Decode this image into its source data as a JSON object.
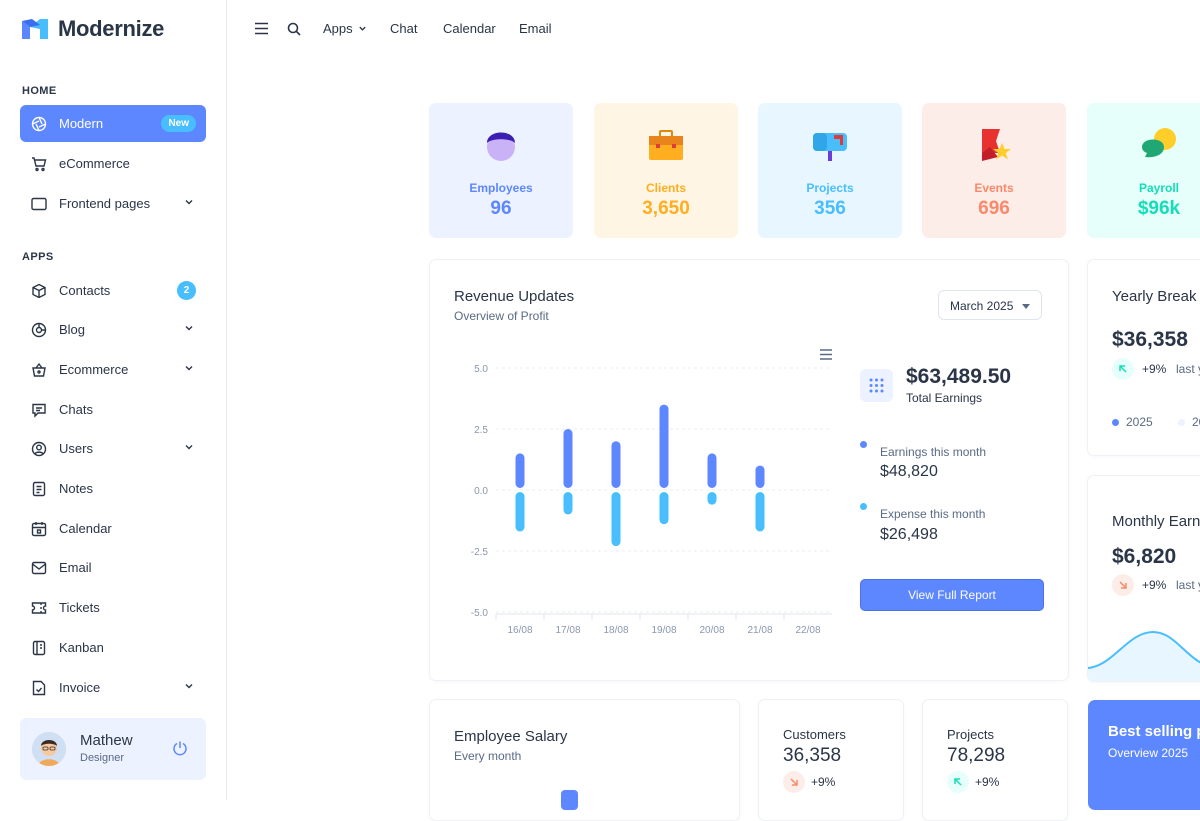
{
  "app": {
    "name": "Modernize"
  },
  "sidebar": {
    "sections": [
      {
        "label": "HOME"
      },
      {
        "label": "APPS"
      }
    ],
    "items": [
      {
        "label": "Modern",
        "icon": "aperture-icon",
        "badge": "New"
      },
      {
        "label": "eCommerce",
        "icon": "shopping-cart-icon"
      },
      {
        "label": "Frontend pages",
        "icon": "app-window-icon"
      },
      {
        "label": "Contacts",
        "icon": "box-icon",
        "badge": "2"
      },
      {
        "label": "Blog",
        "icon": "chart-donut-icon"
      },
      {
        "label": "Ecommerce",
        "icon": "basket-icon"
      },
      {
        "label": "Chats",
        "icon": "message-icon"
      },
      {
        "label": "Users",
        "icon": "user-circle-icon"
      },
      {
        "label": "Notes",
        "icon": "notes-icon"
      },
      {
        "label": "Calendar",
        "icon": "calendar-icon"
      },
      {
        "label": "Email",
        "icon": "mail-icon"
      },
      {
        "label": "Tickets",
        "icon": "ticket-icon"
      },
      {
        "label": "Kanban",
        "icon": "notebook-icon"
      },
      {
        "label": "Invoice",
        "icon": "file-check-icon"
      }
    ],
    "profile": {
      "name": "Mathew",
      "role": "Designer"
    }
  },
  "topbar": {
    "items": [
      "Apps",
      "Chat",
      "Calendar",
      "Email"
    ]
  },
  "stats": [
    {
      "label": "Employees",
      "value": "96",
      "color": "#5d87ff",
      "bg": "#ecf2ff"
    },
    {
      "label": "Clients",
      "value": "3,650",
      "color": "#ffae1f",
      "bg": "#fef5e5"
    },
    {
      "label": "Projects",
      "value": "356",
      "color": "#49beff",
      "bg": "#e8f7ff"
    },
    {
      "label": "Events",
      "value": "696",
      "color": "#fa896b",
      "bg": "#fdede8"
    },
    {
      "label": "Payroll",
      "value": "$96k",
      "color": "#13deb9",
      "bg": "#e6fffa"
    }
  ],
  "revenue": {
    "title": "Revenue Updates",
    "subtitle": "Overview of Profit",
    "select": "March 2025",
    "total": "$63,489.50",
    "total_label": "Total Earnings",
    "earnings_label": "Earnings this month",
    "earnings_value": "$48,820",
    "expense_label": "Expense this month",
    "expense_value": "$26,498",
    "button": "View Full Report"
  },
  "chart_data": {
    "type": "bar",
    "categories": [
      "16/08",
      "17/08",
      "18/08",
      "19/08",
      "20/08",
      "21/08",
      "22/08"
    ],
    "series": [
      {
        "values": [
          1.5,
          2.5,
          2.0,
          3.5,
          1.5,
          1.0,
          0
        ]
      },
      {
        "values": [
          -1.7,
          -1.0,
          -2.3,
          -1.4,
          -0.6,
          -1.7,
          0
        ]
      }
    ],
    "y_ticks": [
      "5.0",
      "2.5",
      "0.0",
      "-2.5",
      "-5.0"
    ],
    "ylim": [
      -5,
      5
    ],
    "colors": [
      "#5d87ff",
      "#49beff"
    ],
    "grid": true
  },
  "yearly": {
    "title": "Yearly Break",
    "value": "$36,358",
    "change": "+9%",
    "suffix": "last y",
    "legend": [
      "2025",
      "20"
    ]
  },
  "monthly": {
    "title": "Monthly Earn",
    "value": "$6,820",
    "change": "+9%",
    "suffix": "last y"
  },
  "salary": {
    "title": "Employee Salary",
    "subtitle": "Every month"
  },
  "customers": {
    "label": "Customers",
    "value": "36,358",
    "change": "+9%"
  },
  "projects_card": {
    "label": "Projects",
    "value": "78,298",
    "change": "+9%"
  },
  "best": {
    "title": "Best selling p",
    "subtitle": "Overview 2025"
  }
}
